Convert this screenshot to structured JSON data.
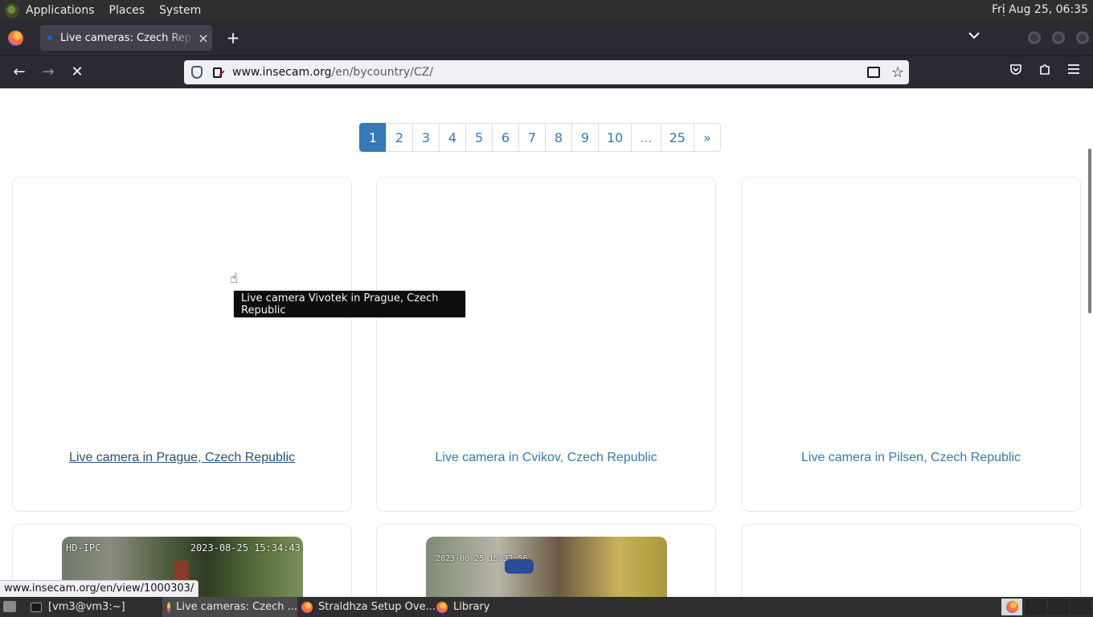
{
  "top_panel": {
    "menus": [
      "Applications",
      "Places",
      "System"
    ],
    "clock": "Fri Aug 25, 06:35"
  },
  "browser": {
    "tab_title": "Live cameras: Czech Republi",
    "tab_close": "×",
    "new_tab": "+",
    "url_host": "www.insecam.org",
    "url_path": "/en/bycountry/CZ/"
  },
  "pagination": {
    "pages": [
      "1",
      "2",
      "3",
      "4",
      "5",
      "6",
      "7",
      "8",
      "9",
      "10",
      "...",
      "25",
      "»"
    ],
    "active": "1"
  },
  "cards": [
    {
      "caption": "Live camera in Prague, Czech Republic"
    },
    {
      "caption": "Live camera in Cvikov, Czech Republic"
    },
    {
      "caption": "Live camera in Pilsen, Czech Republic"
    }
  ],
  "thumbnails": [
    {
      "label_left": "HD-IPC",
      "label_right": "2023-08-25  15:34:43"
    },
    {
      "label_left": "2023-08-25 15:32:56",
      "label_right": ""
    }
  ],
  "tooltip": "Live camera Vivotek in Prague, Czech Republic",
  "status_url": "www.insecam.org/en/view/1000303/",
  "taskbar": {
    "items": [
      "[vm3@vm3:~]",
      "Live cameras: Czech ...",
      "Straldhza Setup Ove...",
      "Library"
    ]
  }
}
